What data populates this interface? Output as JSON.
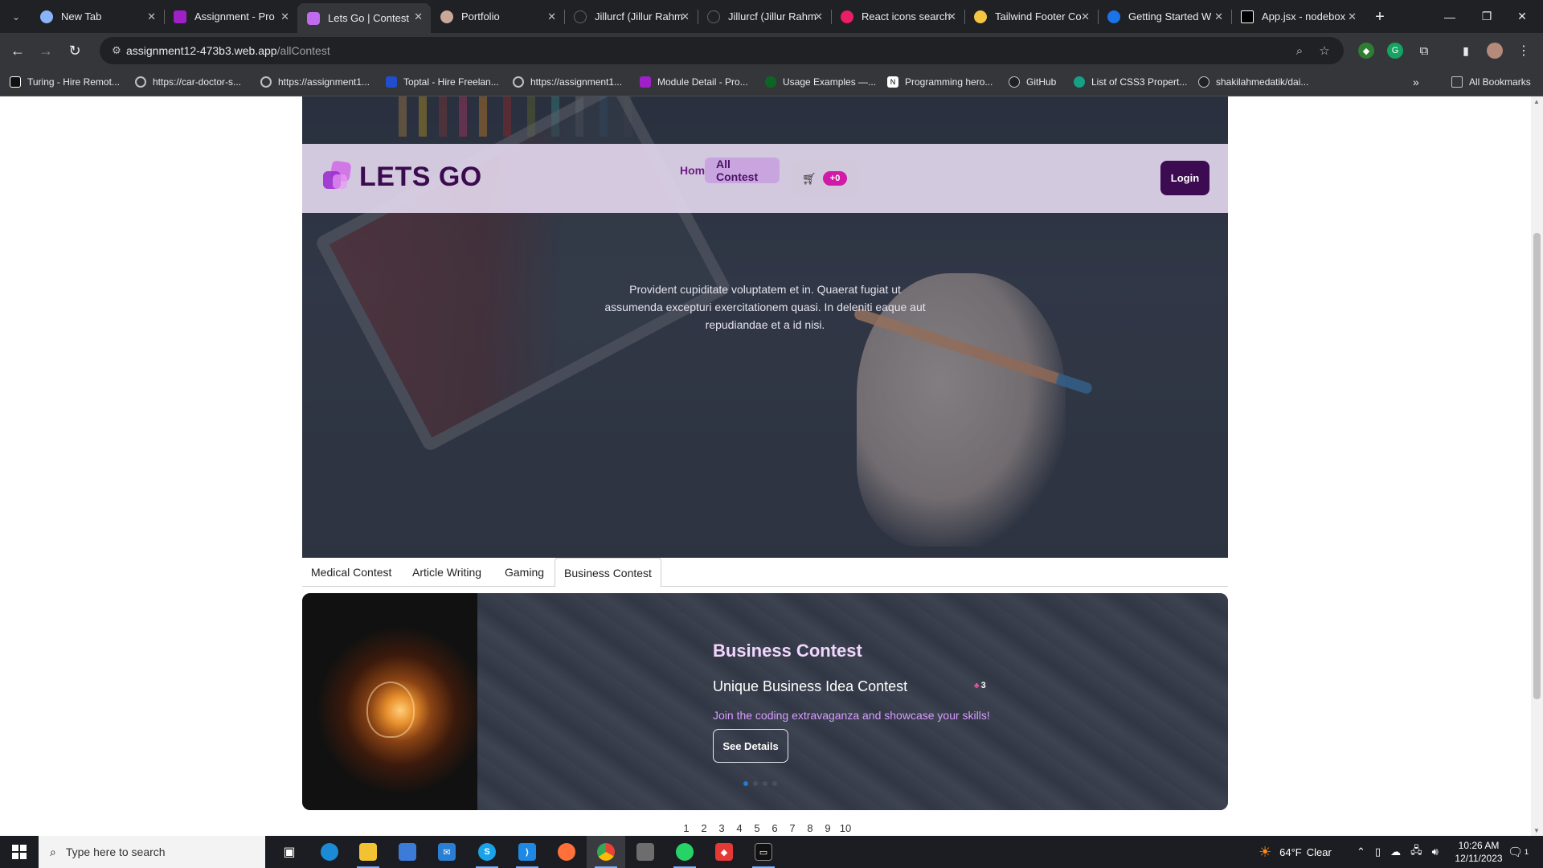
{
  "browser": {
    "tabs": [
      {
        "title": "New Tab",
        "fav_color": "#8ab4f8",
        "icon": "chrome-icon"
      },
      {
        "title": "Assignment - Pro",
        "fav_color": "#a020c8",
        "icon": "assignment-icon"
      },
      {
        "title": "Lets Go | Contest",
        "fav_color": "#c06af0",
        "icon": "letsgo-icon"
      },
      {
        "title": "Portfolio",
        "fav_color": "#c9a89a",
        "icon": "portfolio-icon"
      },
      {
        "title": "Jillurcf (Jillur Rahm",
        "fav_color": "#202124",
        "icon": "github-icon"
      },
      {
        "title": "Jillurcf (Jillur Rahm",
        "fav_color": "#202124",
        "icon": "github-icon"
      },
      {
        "title": "React icons search",
        "fav_color": "#e91e63",
        "icon": "react-icons-icon"
      },
      {
        "title": "Tailwind Footer Co",
        "fav_color": "#f4c542",
        "icon": "tailwind-icon"
      },
      {
        "title": "Getting Started W",
        "fav_color": "#1a73e8",
        "icon": "getting-started-icon"
      },
      {
        "title": "App.jsx - nodebox",
        "fav_color": "#000000",
        "icon": "codesandbox-icon"
      }
    ],
    "active_tab_index": 2,
    "url_host": "assignment12-473b3.web.app",
    "url_path": "/allContest",
    "bookmarks": [
      {
        "label": "Turing - Hire Remot...",
        "color": "#111111",
        "icon": "turing-icon"
      },
      {
        "label": "https://car-doctor-s...",
        "color": "#5f6368",
        "icon": "globe-icon"
      },
      {
        "label": "https://assignment1...",
        "color": "#5f6368",
        "icon": "globe-icon"
      },
      {
        "label": "Toptal - Hire Freelan...",
        "color": "#204ecf",
        "icon": "toptal-icon"
      },
      {
        "label": "https://assignment1...",
        "color": "#5f6368",
        "icon": "globe-icon"
      },
      {
        "label": "Module Detail - Pro...",
        "color": "#a020c8",
        "icon": "module-icon"
      },
      {
        "label": "Usage Examples —...",
        "color": "#0b6623",
        "icon": "usage-icon"
      },
      {
        "label": "Programming hero...",
        "color": "#222222",
        "icon": "notion-icon"
      },
      {
        "label": "GitHub",
        "color": "#202124",
        "icon": "github-icon"
      },
      {
        "label": "List of CSS3 Propert...",
        "color": "#16a085",
        "icon": "css-icon"
      },
      {
        "label": "shakilahmedatik/dai...",
        "color": "#202124",
        "icon": "github-icon"
      }
    ],
    "all_bookmarks_label": "All Bookmarks"
  },
  "site": {
    "logo_text": "LETS GO",
    "nav": [
      {
        "label": "Home",
        "active": false
      },
      {
        "label": "All Contest",
        "active": true
      }
    ],
    "cart_badge": "+0",
    "login_label": "Login",
    "hero_text": "Provident cupiditate voluptatem et in. Quaerat fugiat ut assumenda excepturi exercitationem quasi. In deleniti eaque aut repudiandae et a id nisi.",
    "category_tabs": [
      "Medical Contest",
      "Article Writing",
      "Gaming",
      "Business Contest"
    ],
    "active_category_index": 3,
    "card": {
      "category": "Business Contest",
      "name": "Unique Business Idea Contest",
      "count": "3",
      "description": "Join the coding extravaganza and showcase your skills!",
      "button_label": "See Details",
      "dots_total": 4,
      "dots_active_index": 0
    },
    "pagination": [
      "1",
      "2",
      "3",
      "4",
      "5",
      "6",
      "7",
      "8",
      "9",
      "10"
    ]
  },
  "taskbar": {
    "search_placeholder": "Type here to search",
    "weather_temp": "64°F",
    "weather_text": "Clear",
    "time": "10:26 AM",
    "date": "12/11/2023",
    "notification_badge": "1"
  }
}
